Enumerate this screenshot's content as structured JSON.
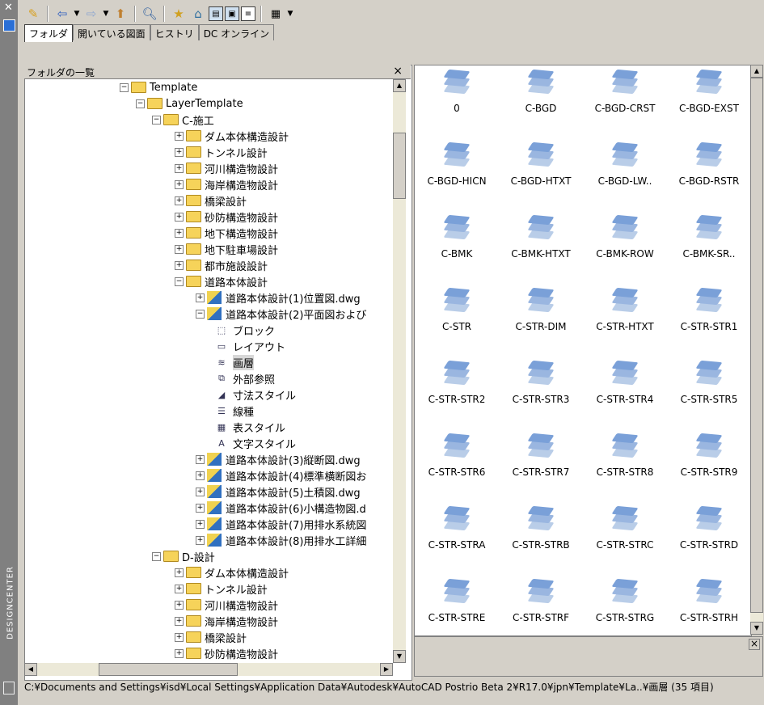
{
  "window": {
    "vertical_title": "DESIGNCENTER"
  },
  "toolbar": {
    "icons": [
      "load-icon",
      "back-icon",
      "forward-icon",
      "up-icon",
      "search-icon",
      "favorites-icon",
      "home-icon",
      "tree-toggle-icon",
      "preview-icon",
      "description-icon",
      "views-icon"
    ]
  },
  "tabs": [
    {
      "label": "フォルダ"
    },
    {
      "label": "開いている図面"
    },
    {
      "label": "ヒストリ"
    },
    {
      "label": "DC オンライン"
    }
  ],
  "folder_pane": {
    "header": "フォルダの一覧",
    "close": "×",
    "tree": [
      {
        "label": "Template",
        "level": 0,
        "type": "folder",
        "expanded": true
      },
      {
        "label": "LayerTemplate",
        "level": 1,
        "type": "folder",
        "expanded": true
      },
      {
        "label": "C-施工",
        "level": 2,
        "type": "folder",
        "expanded": true
      },
      {
        "label": "ダム本体構造設計",
        "level": 3,
        "type": "folder",
        "expanded": false
      },
      {
        "label": "トンネル設計",
        "level": 3,
        "type": "folder",
        "expanded": false
      },
      {
        "label": "河川構造物設計",
        "level": 3,
        "type": "folder",
        "expanded": false
      },
      {
        "label": "海岸構造物設計",
        "level": 3,
        "type": "folder",
        "expanded": false
      },
      {
        "label": "橋梁設計",
        "level": 3,
        "type": "folder",
        "expanded": false
      },
      {
        "label": "砂防構造物設計",
        "level": 3,
        "type": "folder",
        "expanded": false
      },
      {
        "label": "地下構造物設計",
        "level": 3,
        "type": "folder",
        "expanded": false
      },
      {
        "label": "地下駐車場設計",
        "level": 3,
        "type": "folder",
        "expanded": false
      },
      {
        "label": "都市施設設計",
        "level": 3,
        "type": "folder",
        "expanded": false
      },
      {
        "label": "道路本体設計",
        "level": 3,
        "type": "folder",
        "expanded": true
      },
      {
        "label": "道路本体設計(1)位置図.dwg",
        "level": 4,
        "type": "dwg",
        "expanded": false
      },
      {
        "label": "道路本体設計(2)平面図および",
        "level": 4,
        "type": "dwg",
        "expanded": true
      },
      {
        "label": "ブロック",
        "level": 5,
        "type": "sub",
        "icon": "block-icon"
      },
      {
        "label": "レイアウト",
        "level": 5,
        "type": "sub",
        "icon": "layout-icon"
      },
      {
        "label": "画層",
        "level": 5,
        "type": "sub",
        "icon": "layer-icon",
        "selected": true
      },
      {
        "label": "外部参照",
        "level": 5,
        "type": "sub",
        "icon": "xref-icon"
      },
      {
        "label": "寸法スタイル",
        "level": 5,
        "type": "sub",
        "icon": "dimstyle-icon"
      },
      {
        "label": "線種",
        "level": 5,
        "type": "sub",
        "icon": "linetype-icon"
      },
      {
        "label": "表スタイル",
        "level": 5,
        "type": "sub",
        "icon": "tablestyle-icon"
      },
      {
        "label": "文字スタイル",
        "level": 5,
        "type": "sub",
        "icon": "textstyle-icon"
      },
      {
        "label": "道路本体設計(3)縦断図.dwg",
        "level": 4,
        "type": "dwg",
        "expanded": false
      },
      {
        "label": "道路本体設計(4)標準横断図お",
        "level": 4,
        "type": "dwg",
        "expanded": false
      },
      {
        "label": "道路本体設計(5)土積図.dwg",
        "level": 4,
        "type": "dwg",
        "expanded": false
      },
      {
        "label": "道路本体設計(6)小構造物図.d",
        "level": 4,
        "type": "dwg",
        "expanded": false
      },
      {
        "label": "道路本体設計(7)用排水系統図",
        "level": 4,
        "type": "dwg",
        "expanded": false
      },
      {
        "label": "道路本体設計(8)用排水工詳細",
        "level": 4,
        "type": "dwg",
        "expanded": false
      },
      {
        "label": "D-設計",
        "level": 2,
        "type": "folder",
        "expanded": true
      },
      {
        "label": "ダム本体構造設計",
        "level": 3,
        "type": "folder",
        "expanded": false
      },
      {
        "label": "トンネル設計",
        "level": 3,
        "type": "folder",
        "expanded": false
      },
      {
        "label": "河川構造物設計",
        "level": 3,
        "type": "folder",
        "expanded": false
      },
      {
        "label": "海岸構造物設計",
        "level": 3,
        "type": "folder",
        "expanded": false
      },
      {
        "label": "橋梁設計",
        "level": 3,
        "type": "folder",
        "expanded": false
      },
      {
        "label": "砂防構造物設計",
        "level": 3,
        "type": "folder",
        "expanded": false
      }
    ]
  },
  "layers": [
    "0",
    "C-BGD",
    "C-BGD-CRST",
    "C-BGD-EXST",
    "C-BGD-HICN",
    "C-BGD-HTXT",
    "C-BGD-LW..",
    "C-BGD-RSTR",
    "C-BMK",
    "C-BMK-HTXT",
    "C-BMK-ROW",
    "C-BMK-SR..",
    "C-STR",
    "C-STR-DIM",
    "C-STR-HTXT",
    "C-STR-STR1",
    "C-STR-STR2",
    "C-STR-STR3",
    "C-STR-STR4",
    "C-STR-STR5",
    "C-STR-STR6",
    "C-STR-STR7",
    "C-STR-STR8",
    "C-STR-STR9",
    "C-STR-STRA",
    "C-STR-STRB",
    "C-STR-STRC",
    "C-STR-STRD",
    "C-STR-STRE",
    "C-STR-STRF",
    "C-STR-STRG",
    "C-STR-STRH"
  ],
  "preview_close": "×",
  "status": "C:¥Documents and Settings¥isd¥Local Settings¥Application Data¥Autodesk¥AutoCAD Postrio Beta 2¥R17.0¥jpn¥Template¥La..¥画層 (35 項目)"
}
